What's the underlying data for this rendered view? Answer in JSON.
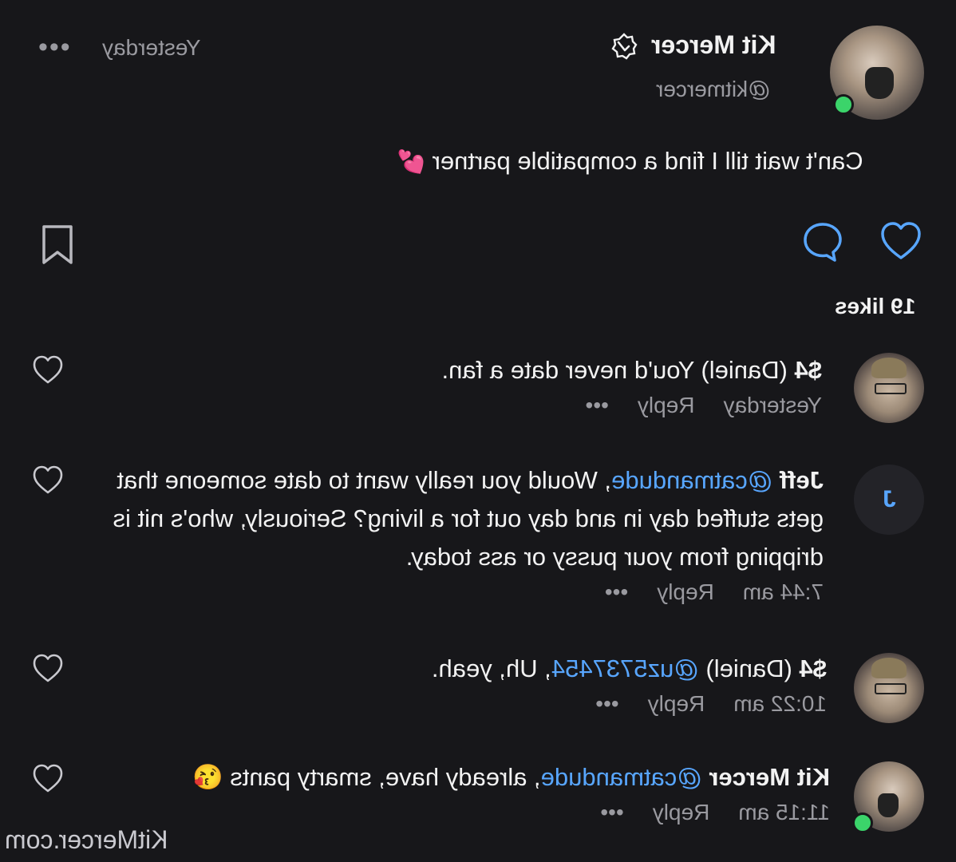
{
  "post": {
    "author_name": "Kit Mercer",
    "author_handle": "@kitmercer",
    "time": "Yesterday",
    "more": "•••",
    "text": "Can't wait till I find a compatible partner",
    "text_emoji": "💕",
    "likes": "19 likes"
  },
  "comments": [
    {
      "name": "$4",
      "text_pre": " (Daniel) ",
      "mention": "",
      "text_post": "You'd never date a fan.",
      "time": "Yesterday",
      "reply": "Reply",
      "more": "•••",
      "avatar": "photo-man"
    },
    {
      "name": "Jeff",
      "avatar_letter": "J",
      "text_pre": " ",
      "mention": "@catmandude",
      "text_post": ", Would you really want to date someone that gets stuffed day in and day out for a living? Seriously, who's nit is dripping from your pussy or ass today.",
      "time": "7:44 am",
      "reply": "Reply",
      "more": "•••",
      "avatar": "letter"
    },
    {
      "name": "$4",
      "text_pre": " (Daniel) ",
      "mention": "@uz5737454",
      "text_post": ", Uh, yeah.",
      "time": "10:22 am",
      "reply": "Reply",
      "more": "•••",
      "avatar": "photo-man"
    },
    {
      "name": "Kit Mercer",
      "text_pre": " ",
      "mention": "@catmandude",
      "text_post": ", already have, smarty pants ",
      "emoji": "😘",
      "time": "11:15 am",
      "reply": "Reply",
      "more": "•••",
      "avatar": "photo-kit"
    }
  ],
  "watermark": "KitMercer.com",
  "colors": {
    "background": "#17171a",
    "accent": "#58a6ff",
    "online": "#3bd46a",
    "muted": "#9a9aa0"
  },
  "icons": [
    "verified-icon",
    "more-icon",
    "like-icon",
    "comment-icon",
    "bookmark-icon",
    "heart-icon"
  ]
}
